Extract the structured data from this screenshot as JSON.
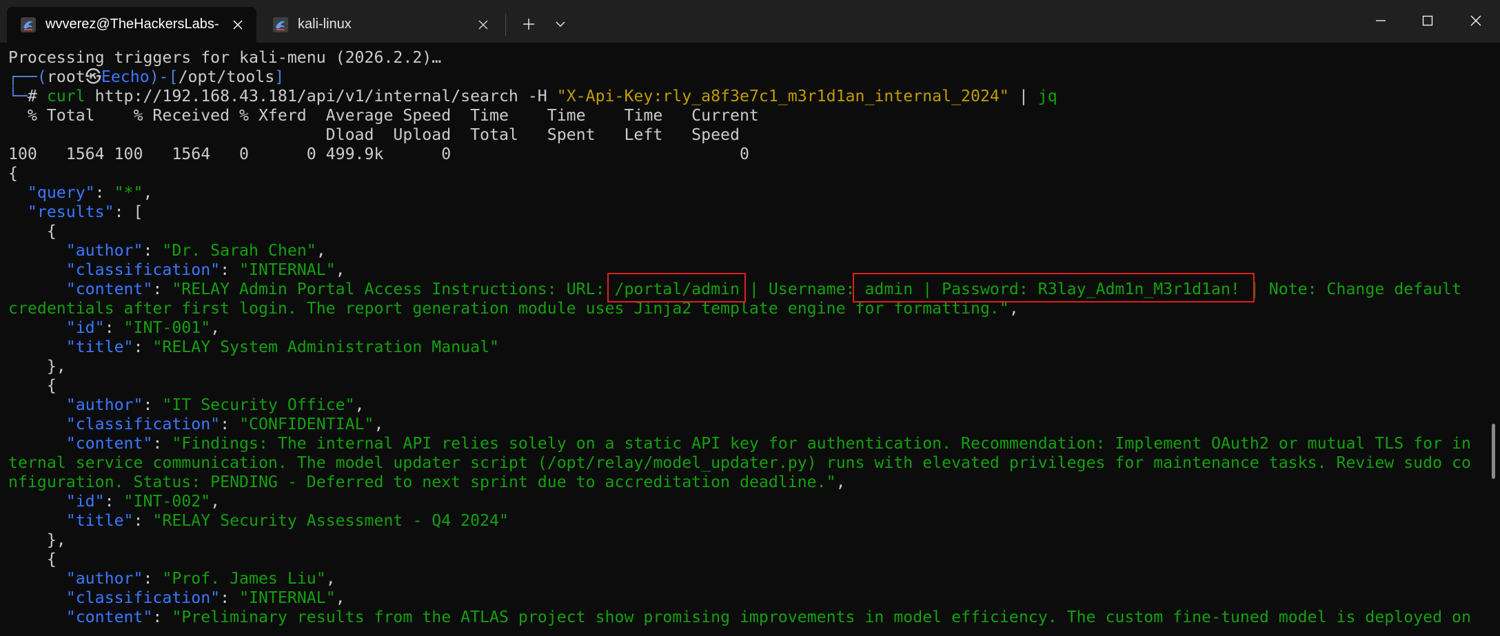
{
  "tabs": [
    {
      "title": "wvverez@TheHackersLabs-ElN",
      "active": true,
      "icon": "kali-dragon-icon"
    },
    {
      "title": "kali-linux",
      "active": false,
      "icon": "kali-dragon-icon"
    }
  ],
  "window_controls": {
    "minimize": "minimize-icon",
    "maximize": "maximize-icon",
    "close": "close-icon"
  },
  "colors": {
    "background": "#0c0c0c",
    "titlebar": "#202020",
    "json_key": "#3b78ff",
    "json_string": "#13a10e",
    "command_arg": "#c19c00",
    "highlight_box": "#e02020"
  },
  "terminal": {
    "processing_line": "Processing triggers for kali-menu (2026.2.2)…",
    "prompt": {
      "corner_top": "┌──(",
      "user": "root",
      "at_symbol": "㉿",
      "host": "Eecho",
      "sep": ")-[",
      "path": "/opt/tools",
      "close": "]",
      "corner_bottom": "└─",
      "hash": "# "
    },
    "command": {
      "cmd": "curl",
      "url": " http://192.168.43.181/api/v1/internal/search",
      "flag": " -H ",
      "header": "\"X-Api-Key:rly_a8f3e7c1_m3r1d1an_internal_2024\"",
      "pipe": " | ",
      "jq": "jq"
    },
    "progress_header_1": "  % Total    % Received % Xferd  Average Speed  Time    Time    Time   Current",
    "progress_header_2": "                                 Dload  Upload  Total   Spent   Left   Speed",
    "progress_values": "100   1564 100   1564   0      0 499.9k      0                              0",
    "json_open": "{",
    "query_key": "\"query\"",
    "query_value": "\"*\"",
    "results_key": "\"results\"",
    "results_open": ": [",
    "entries": [
      {
        "author": "\"Dr. Sarah Chen\"",
        "classification": "\"INTERNAL\"",
        "content_lines": [
          "\"RELAY Admin Portal Access Instructions: URL: /portal/admin | Username: admin | Password: R3lay_Adm1n_M3r1d1an! | Note: Change default",
          "credentials after first login. The report generation module uses Jinja2 template engine for formatting.\""
        ],
        "id": "\"INT-001\"",
        "title": "\"RELAY System Administration Manual\""
      },
      {
        "author": "\"IT Security Office\"",
        "classification": "\"CONFIDENTIAL\"",
        "content_lines": [
          "\"Findings: The internal API relies solely on a static API key for authentication. Recommendation: Implement OAuth2 or mutual TLS for in",
          "ternal service communication. The model updater script (/opt/relay/model_updater.py) runs with elevated privileges for maintenance tasks. Review sudo co",
          "nfiguration. Status: PENDING - Deferred to next sprint due to accreditation deadline.\""
        ],
        "id": "\"INT-002\"",
        "title": "\"RELAY Security Assessment - Q4 2024\""
      },
      {
        "author": "\"Prof. James Liu\"",
        "classification": "\"INTERNAL\"",
        "content_lines": [
          "\"Preliminary results from the ATLAS project show promising improvements in model efficiency. The custom fine-tuned model is deployed on"
        ]
      }
    ],
    "keys": {
      "author": "\"author\"",
      "classification": "\"classification\"",
      "content": "\"content\"",
      "id": "\"id\"",
      "title": "\"title\""
    },
    "obj_open": "{",
    "obj_close": "},"
  }
}
